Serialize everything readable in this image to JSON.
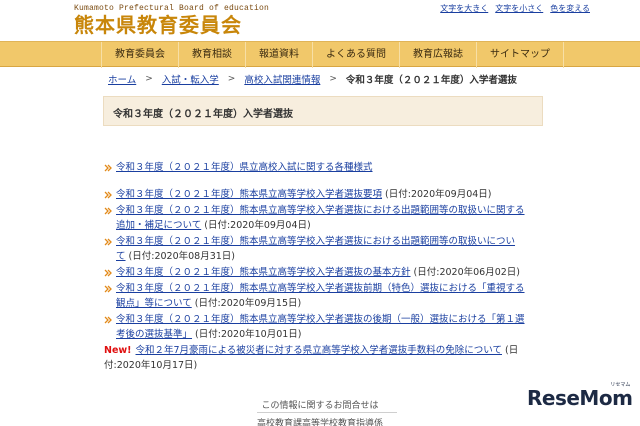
{
  "header": {
    "logo_sub": "Kumamoto Prefectural Board of education",
    "logo_main": "熊本県教育委員会",
    "util_links": [
      "文字を大きく",
      "文字を小さく",
      "色を変える"
    ]
  },
  "nav": {
    "items": [
      "教育委員会",
      "教育相談",
      "報道資料",
      "よくある質問",
      "教育広報誌",
      "サイトマップ"
    ]
  },
  "breadcrumb": {
    "items": [
      "ホーム",
      "入試・転入学",
      "高校入試関連情報"
    ],
    "separator": ">",
    "current": "令和３年度（２０２１年度）入学者選抜"
  },
  "page": {
    "title": "令和３年度（２０２１年度）入学者選抜"
  },
  "links": [
    {
      "lines": [
        {
          "link": "令和３年度（２０２１年度）県立高校入試に関する各種様式",
          "text": ""
        }
      ]
    },
    {
      "lines": [
        {
          "link": "令和３年度（２０２１年度）熊本県立高等学校入学者選抜要項",
          "text": " (日付:2020年09月04日)"
        }
      ]
    },
    {
      "lines": [
        {
          "link": "令和３年度（２０２１年度）熊本県立高等学校入学者選抜における出題範囲等の取扱いに関する",
          "text": ""
        },
        {
          "link": "追加・補足について",
          "text": " (日付:2020年09月04日)"
        }
      ]
    },
    {
      "lines": [
        {
          "link": "令和３年度（２０２１年度）熊本県立高等学校入学者選抜における出題範囲等の取扱いについ",
          "text": ""
        },
        {
          "link": "て",
          "text": " (日付:2020年08月31日)"
        }
      ]
    },
    {
      "lines": [
        {
          "link": "令和３年度（２０２１年度）熊本県立高等学校入学者選抜の基本方針",
          "text": " (日付:2020年06月02日)"
        }
      ]
    },
    {
      "lines": [
        {
          "link": "令和３年度（２０２１年度）熊本県立高等学校入学者選抜前期（特色）選抜における「重視する",
          "text": ""
        },
        {
          "link": "観点」等について",
          "text": " (日付:2020年09月15日)"
        }
      ]
    },
    {
      "lines": [
        {
          "link": "令和３年度（２０２１年度）熊本県立高等学校入学者選抜の後期（一般）選抜における「第１選",
          "text": ""
        },
        {
          "link": "考後の選抜基準」",
          "text": " (日付:2020年10月01日)"
        }
      ]
    },
    {
      "new": "New!",
      "lines": [
        {
          "link": "令和２年7月豪雨による被災者に対する県立高等学校入学者選抜手数料の免除について",
          "text": " (日"
        },
        {
          "link": "",
          "text": "付:2020年10月17日)"
        }
      ]
    }
  ],
  "contact": {
    "heading": "この情報に関するお問合せは",
    "dept": "高校教育課高等学校教育指導係"
  },
  "watermark": {
    "text": "ReseMom",
    "sub": "リセマム"
  },
  "colors": {
    "nav_bg": "#f1c86a",
    "logo": "#c8860a",
    "link": "#1a3fa0",
    "new": "#e01010",
    "title_box": "#f7eede"
  }
}
